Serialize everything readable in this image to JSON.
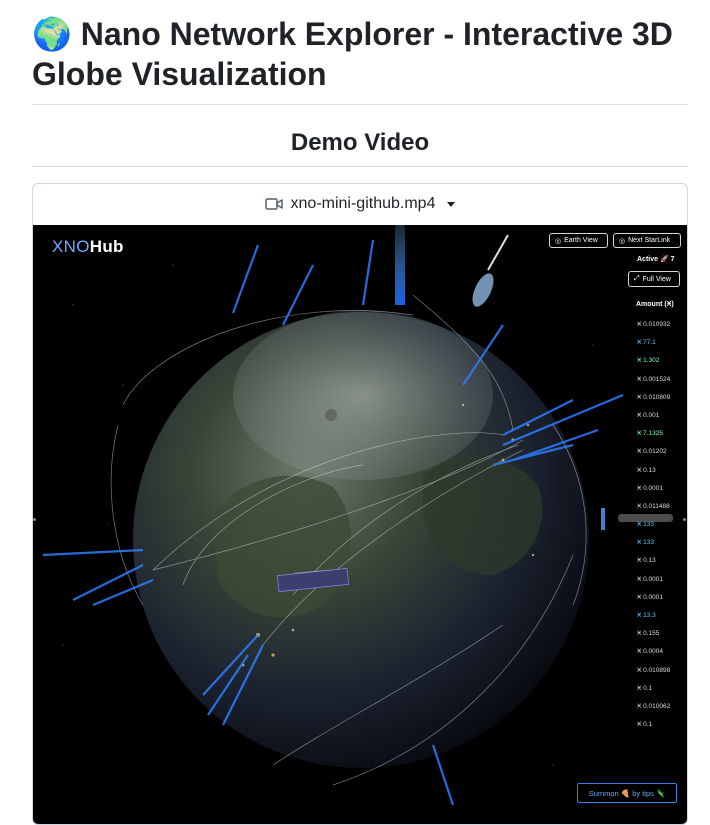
{
  "header": {
    "title_icon": "🌍",
    "title": "Nano Network Explorer - Interactive 3D Globe Visualization"
  },
  "section": {
    "title": "Demo Video"
  },
  "video": {
    "filename": "xno-mini-github.mp4",
    "icons": {
      "camera": "video-camera-icon",
      "dropdown": "caret-down-icon"
    }
  },
  "app": {
    "logo_prefix": "XNO",
    "logo_suffix": "Hub",
    "buttons": {
      "earth_view": "Earth View",
      "next_starlink": "Next StarLink",
      "full_view": "Full View",
      "summon": "Summon 🍕 by tips 🦎"
    },
    "active_label": "Active",
    "active_icon": "🚀",
    "active_count": "7",
    "amount_header": "Amount (Ӿ)",
    "amounts": [
      "Ӿ 0.010932",
      "Ӿ 77.1",
      "Ӿ 1.302",
      "Ӿ 0.001524",
      "Ӿ 0.010809",
      "Ӿ 0.001",
      "Ӿ 7.1325",
      "Ӿ 0.01202",
      "Ӿ 0.13",
      "Ӿ 0.0001",
      "Ӿ 0.011488",
      "Ӿ 133",
      "Ӿ 133",
      "Ӿ 0.13",
      "Ӿ 0.0001",
      "Ӿ 0.0001",
      "Ӿ 13.3",
      "Ӿ 0.155",
      "Ӿ 0.0004",
      "Ӿ 0.010898",
      "Ӿ 0.1",
      "Ӿ 0.010062",
      "Ӿ 0.1"
    ],
    "amount_colors": {
      "default": "#d7dbe0",
      "highlight": "#59c9ff",
      "green": "#7dffb5"
    }
  }
}
